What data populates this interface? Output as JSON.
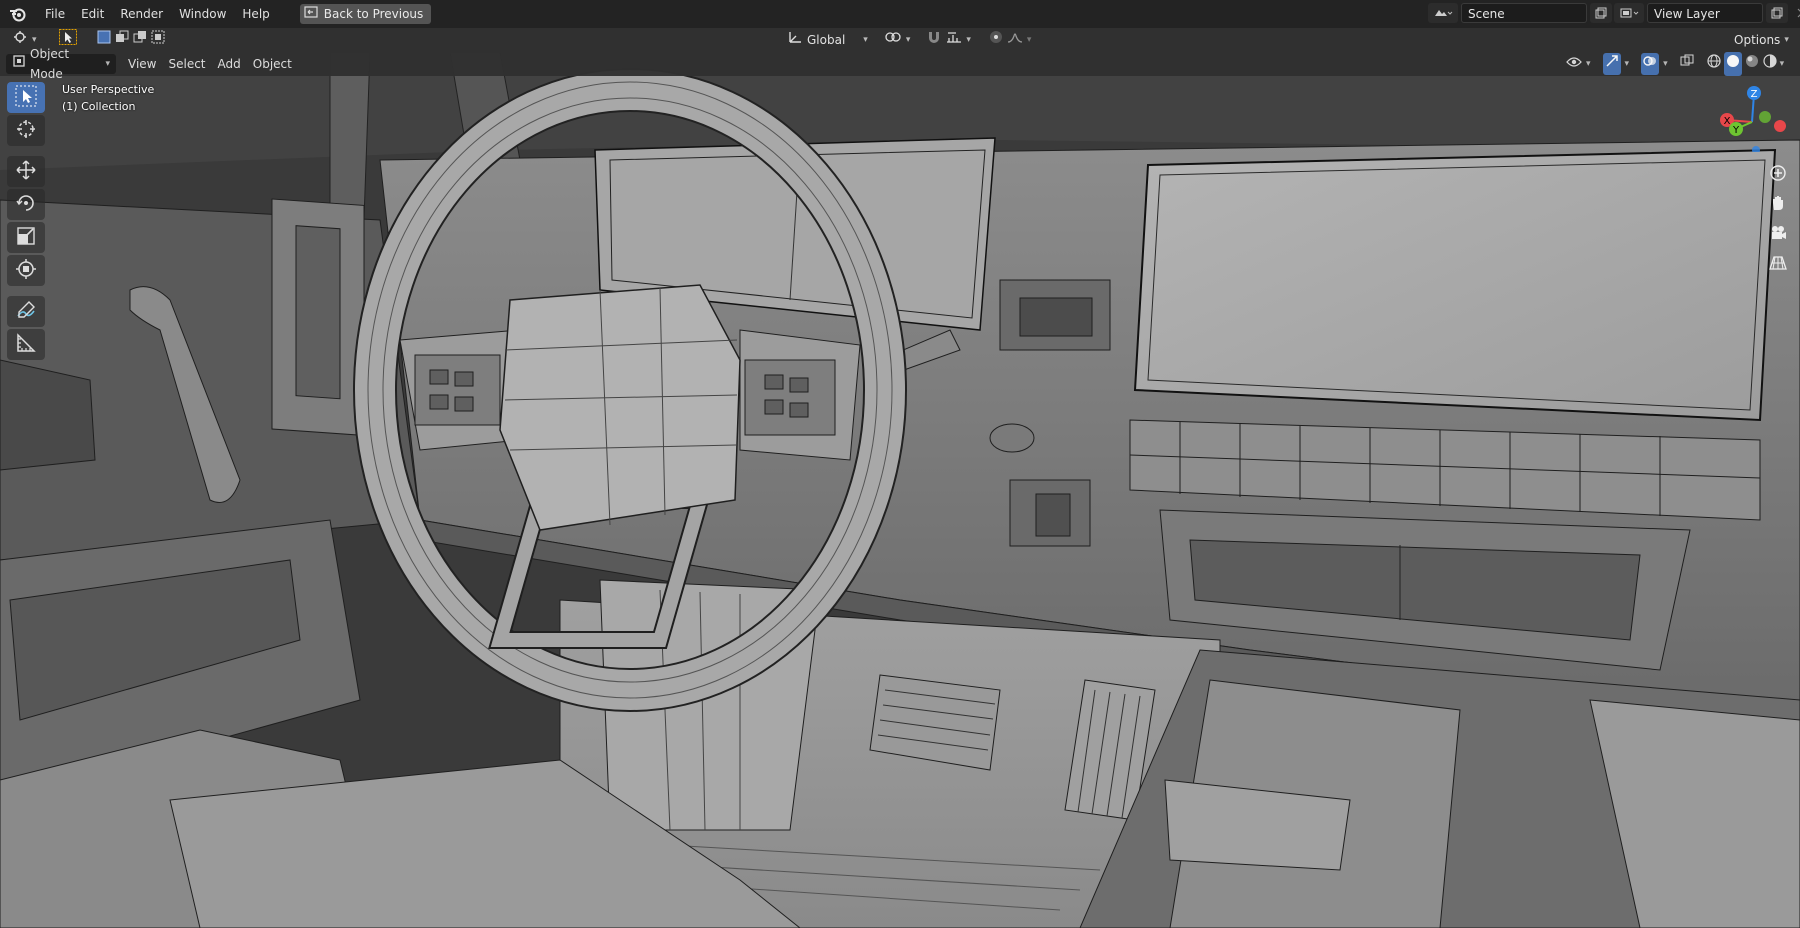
{
  "menubar": {
    "items": [
      "File",
      "Edit",
      "Render",
      "Window",
      "Help"
    ],
    "back_button": "Back to Previous",
    "scene_name": "Scene",
    "view_layer_name": "View Layer"
  },
  "tool_header": {
    "orientation": "Global",
    "options_label": "Options"
  },
  "viewport_header": {
    "mode": "Object Mode",
    "menus": [
      "View",
      "Select",
      "Add",
      "Object"
    ]
  },
  "viewport": {
    "perspective_label": "User Perspective",
    "collection_label": "(1) Collection",
    "background_color": "#3d3d3d",
    "active_tool_color": "#4772b3"
  },
  "gizmo": {
    "x_label": "X",
    "y_label": "Y",
    "z_label": "Z",
    "x_color": "#e8474a",
    "y_color": "#6ec431",
    "z_color": "#2f85e6"
  },
  "toolbar": {
    "tools": [
      "select-box",
      "cursor",
      "move",
      "rotate",
      "scale",
      "transform",
      "annotate",
      "measure"
    ],
    "active": "select-box"
  }
}
